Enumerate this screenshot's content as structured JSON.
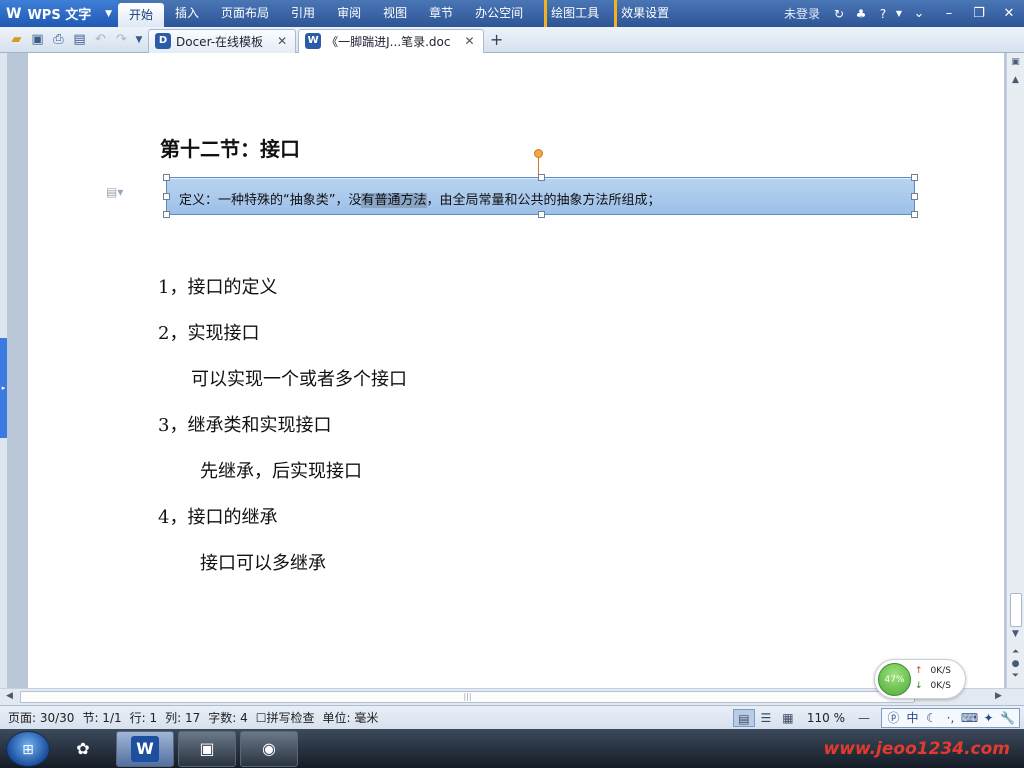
{
  "menubar": {
    "app_title": "WPS 文字",
    "items": [
      "开始",
      "插入",
      "页面布局",
      "引用",
      "审阅",
      "视图",
      "章节",
      "办公空间"
    ],
    "tools": [
      "绘图工具",
      "效果设置"
    ],
    "login": "未登录"
  },
  "tabs": [
    {
      "label": "Docer-在线模板",
      "icon": "D"
    },
    {
      "label": "《一脚踹进J...笔录.doc",
      "icon": "W"
    }
  ],
  "document": {
    "title": "第十二节：接口",
    "textbox": {
      "before": "定义：一种特殊的“抽象类”，没",
      "highlighted": "有普通方法",
      "after": "，由全局常量和公共的抽象方法所组成；"
    },
    "lines": [
      "1，接口的定义",
      "2，实现接口",
      "可以实现一个或者多个接口",
      "3，继承类和实现接口",
      "先继承，后实现接口",
      "4，接口的继承",
      "接口可以多继承"
    ]
  },
  "statusbar": {
    "page": "页面: 30/30",
    "section": "节: 1/1",
    "row": "行: 1",
    "col": "列: 17",
    "chars": "字数: 4",
    "spell": "拼写检查",
    "unit": "单位: 毫米",
    "zoom": "110 %",
    "ime": [
      "中",
      "☾",
      "·,",
      "⌨",
      "✦",
      "🔧"
    ]
  },
  "network": {
    "percent": "47%",
    "up": "0K/S",
    "down": "0K/S"
  },
  "taskbar": {
    "wps_label": "W",
    "watermark": "www.jeoo1234.com"
  }
}
